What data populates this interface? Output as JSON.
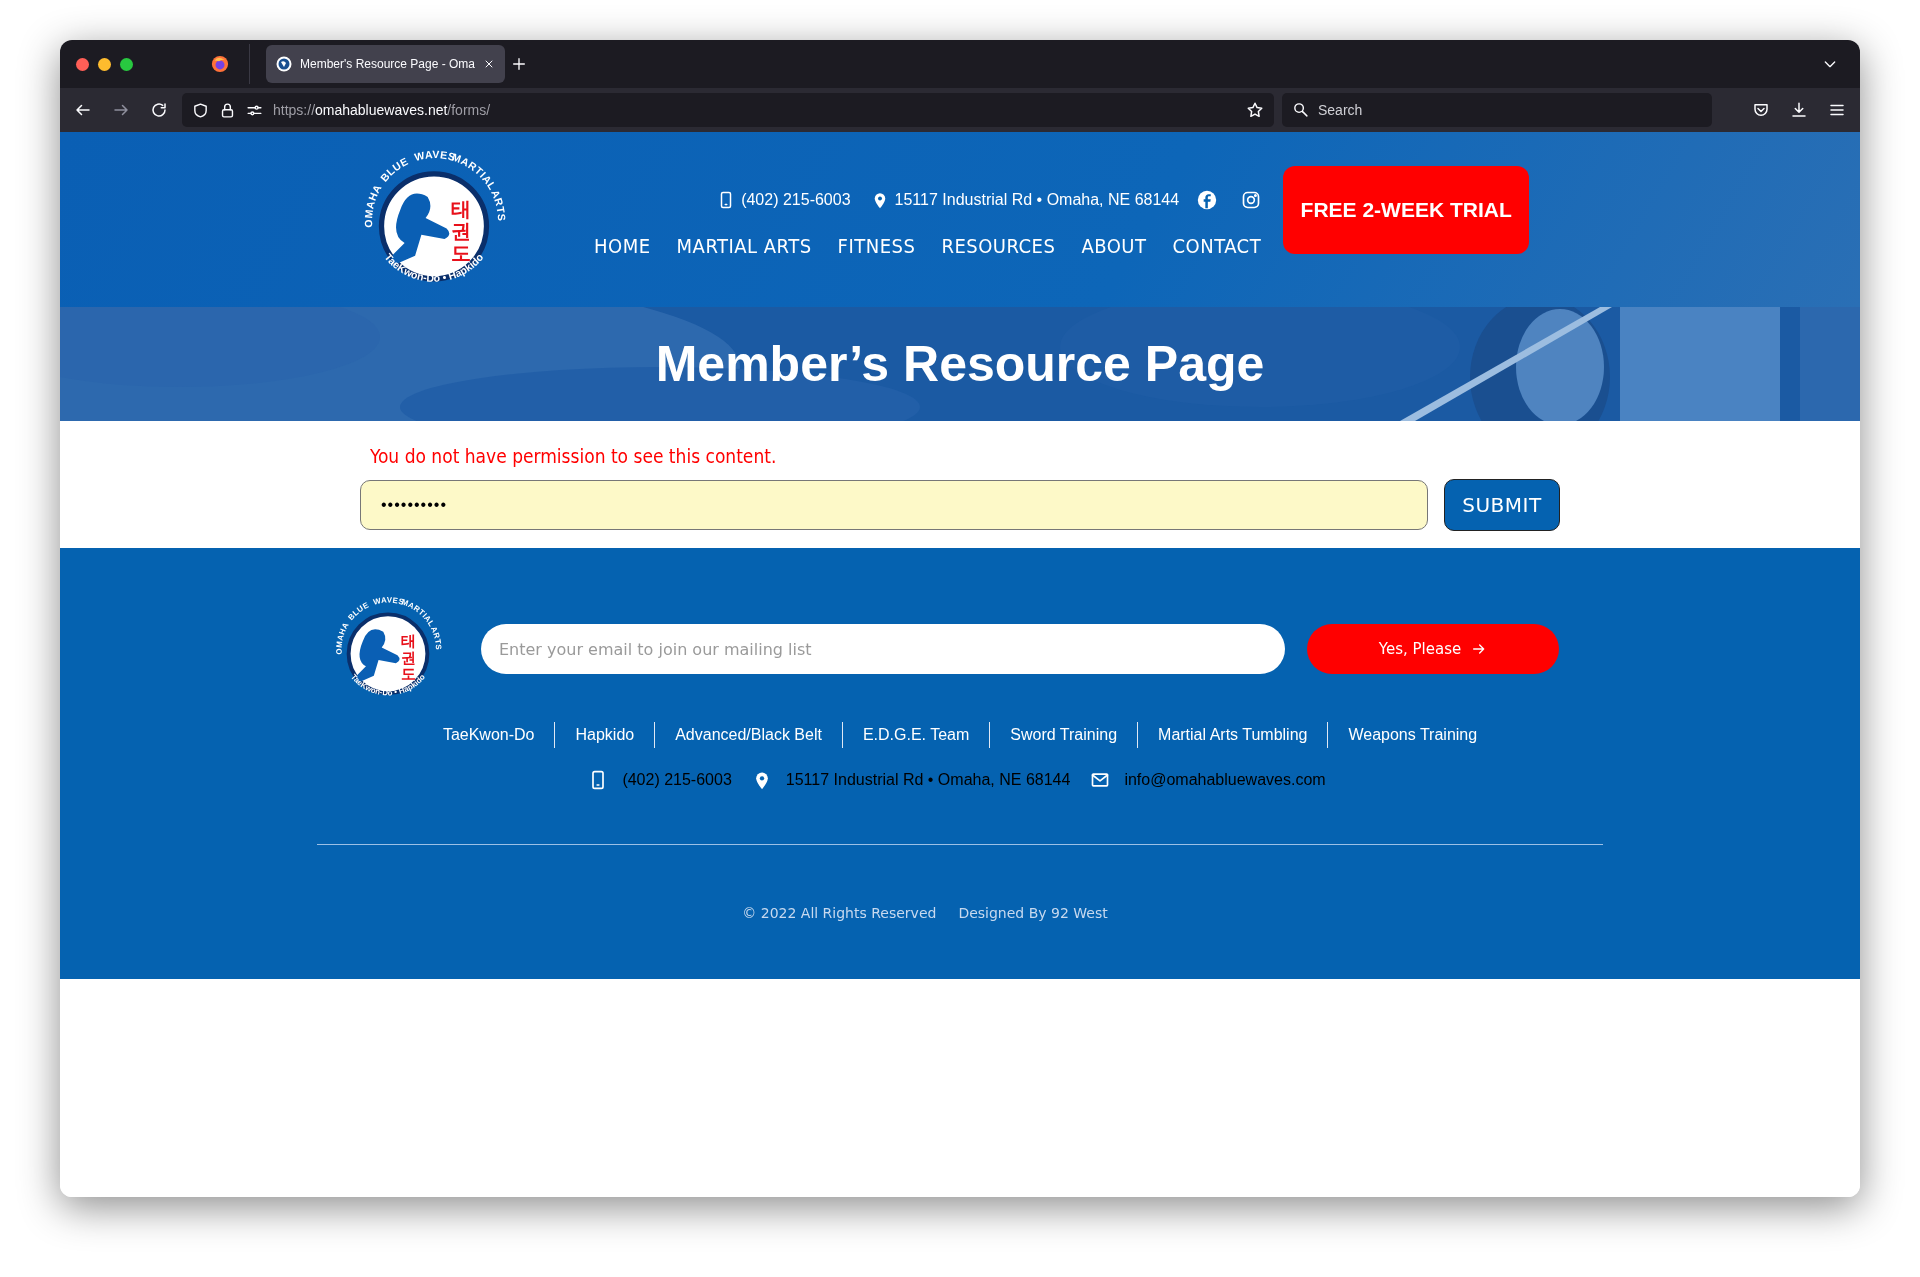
{
  "browser": {
    "tab_title": "Member's Resource Page - Oma",
    "url": {
      "scheme": "https://",
      "domain": "omahabluewaves.net",
      "path": "/forms/"
    },
    "search": {
      "placeholder": "Search"
    }
  },
  "header": {
    "logo": {
      "arc_words": [
        "OMAHA",
        "BLUE",
        "WAVES",
        "MARTIAL",
        "ARTS"
      ],
      "korean": "태권도",
      "tagline": "TaeKwon-Do • Hapkido"
    },
    "phone": "(402) 215-6003",
    "address": "15117 Industrial Rd • Omaha, NE 68144",
    "trial_button": "FREE 2-WEEK TRIAL",
    "nav": [
      {
        "label": "HOME"
      },
      {
        "label": "MARTIAL ARTS"
      },
      {
        "label": "FITNESS"
      },
      {
        "label": "RESOURCES"
      },
      {
        "label": "ABOUT"
      },
      {
        "label": "CONTACT"
      }
    ]
  },
  "hero": {
    "title": "Member’s Resource Page"
  },
  "protected_form": {
    "message": "You do not have permission to see this content.",
    "password_value": "••••••••••",
    "submit": "SUBMIT"
  },
  "footer": {
    "logo": {
      "arc_words": [
        "OMAHA",
        "BLUE",
        "WAVES",
        "MARTIAL",
        "ARTS"
      ],
      "korean": "태권도",
      "tagline": "TaeKwon-Do • Hapkido"
    },
    "email": {
      "placeholder": "Enter your email to join our mailing list"
    },
    "subscribe_button": "Yes, Please",
    "links": [
      {
        "label": "TaeKwon-Do"
      },
      {
        "label": "Hapkido"
      },
      {
        "label": "Advanced/Black Belt"
      },
      {
        "label": "E.D.G.E. Team"
      },
      {
        "label": "Sword Training"
      },
      {
        "label": "Martial Arts Tumbling"
      },
      {
        "label": "Weapons Training"
      }
    ],
    "phone": "(402) 215-6003",
    "address": "15117 Industrial Rd • Omaha, NE 68144",
    "email_address": "info@omahabluewaves.com",
    "copyright": "© 2022 All Rights Reserved",
    "credit": "Designed By 92 West"
  }
}
